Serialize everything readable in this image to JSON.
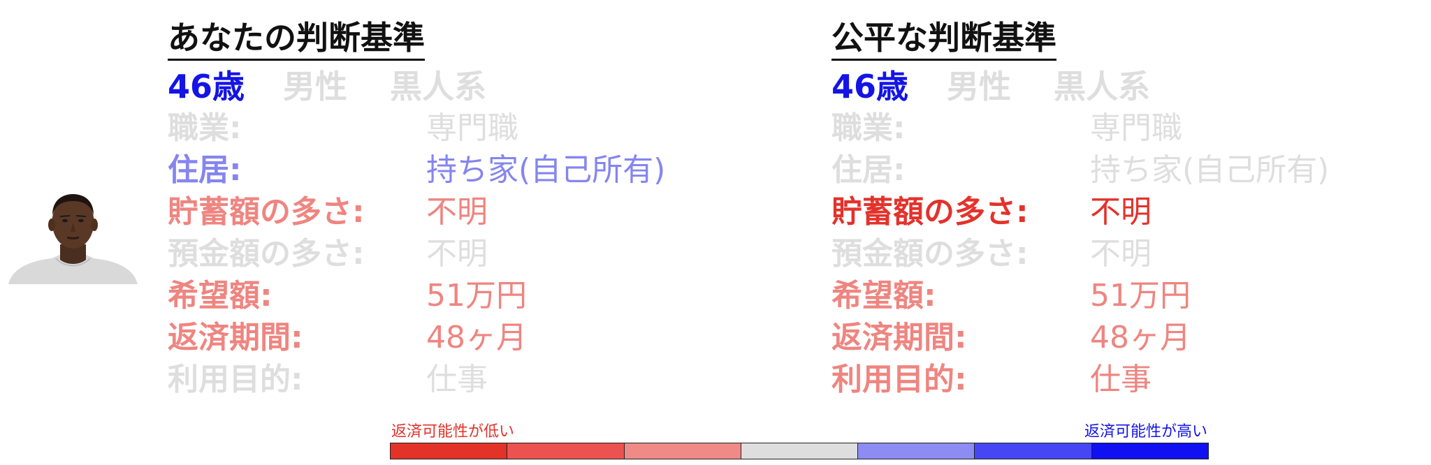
{
  "colors": {
    "title": "#111111",
    "faded": "#dedede",
    "blue_strong": "#1414e6",
    "blue_light": "#8585f0",
    "red_strong": "#e3322b",
    "red_light": "#ef8580",
    "scale": [
      "#e33228",
      "#ec5350",
      "#ef8a86",
      "#dedede",
      "#8c8cf2",
      "#4646f4",
      "#1010f2"
    ]
  },
  "left_panel": {
    "title": "あなたの判断基準",
    "age": "46歳",
    "gender": "男性",
    "race": "黒人系",
    "age_color": "#1414e6",
    "gender_color": "#dedede",
    "race_color": "#dedede",
    "attributes": [
      {
        "label": "職業:",
        "value": "専門職",
        "color": "#dedede"
      },
      {
        "label": "住居:",
        "value": "持ち家(自己所有)",
        "color": "#8585f0"
      },
      {
        "label": "貯蓄額の多さ:",
        "value": "不明",
        "color": "#ef8580"
      },
      {
        "label": "預金額の多さ:",
        "value": "不明",
        "color": "#dedede"
      },
      {
        "label": "希望額:",
        "value": "51万円",
        "color": "#ef8580"
      },
      {
        "label": "返済期間:",
        "value": "48ヶ月",
        "color": "#ef8580"
      },
      {
        "label": "利用目的:",
        "value": "仕事",
        "color": "#dedede"
      }
    ]
  },
  "right_panel": {
    "title": "公平な判断基準",
    "age": "46歳",
    "gender": "男性",
    "race": "黒人系",
    "age_color": "#1414e6",
    "gender_color": "#dedede",
    "race_color": "#dedede",
    "attributes": [
      {
        "label": "職業:",
        "value": "専門職",
        "color": "#dedede"
      },
      {
        "label": "住居:",
        "value": "持ち家(自己所有)",
        "color": "#dedede"
      },
      {
        "label": "貯蓄額の多さ:",
        "value": "不明",
        "color": "#e3322b"
      },
      {
        "label": "預金額の多さ:",
        "value": "不明",
        "color": "#dedede"
      },
      {
        "label": "希望額:",
        "value": "51万円",
        "color": "#ef8580"
      },
      {
        "label": "返済期間:",
        "value": "48ヶ月",
        "color": "#ef8580"
      },
      {
        "label": "利用目的:",
        "value": "仕事",
        "color": "#ef8580"
      }
    ]
  },
  "scale": {
    "low_label": "返済可能性が低い",
    "high_label": "返済可能性が高い",
    "low_color": "#e3322b",
    "high_color": "#1414e6"
  },
  "avatar": {
    "icon": "person-photo-icon"
  }
}
